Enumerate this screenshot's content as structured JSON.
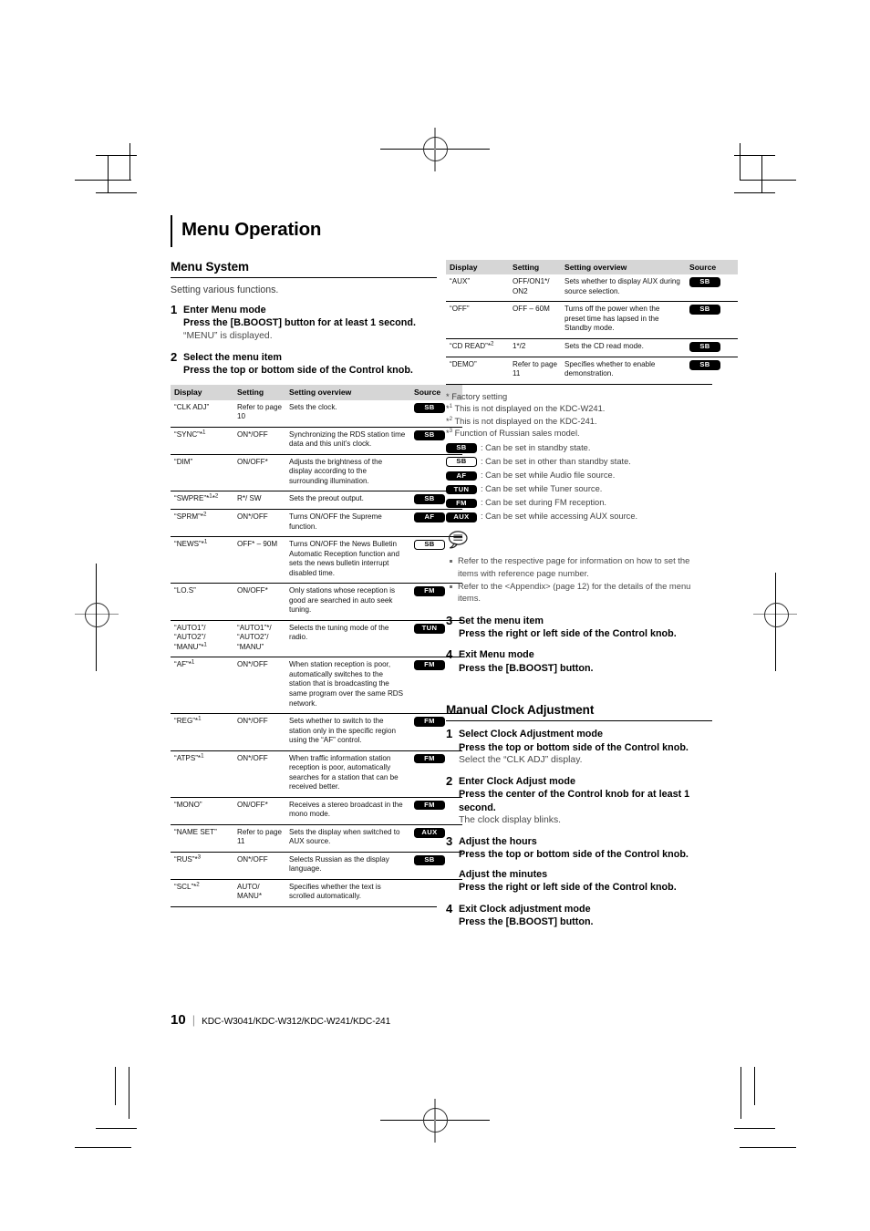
{
  "page_title": "Menu Operation",
  "left": {
    "section_title": "Menu System",
    "lead": "Setting various functions.",
    "steps": [
      {
        "num": "1",
        "hd": "Enter Menu mode",
        "sub": "Press the [B.BOOST] button for at least 1 second.",
        "note": "“MENU” is displayed."
      },
      {
        "num": "2",
        "hd": "Select the menu item",
        "sub": "Press the top or bottom side of the Control knob.",
        "note": ""
      }
    ],
    "table": {
      "headers": [
        "Display",
        "Setting",
        "Setting overview",
        "Source"
      ],
      "rows": [
        {
          "display": "“CLK ADJ”",
          "display_sup": "",
          "setting": "Refer to page 10",
          "overview": "Sets the clock.",
          "badge": "SB",
          "badge_style": "solid"
        },
        {
          "display": "“SYNC”",
          "display_sup": "*1",
          "setting": "ON*/OFF",
          "overview": "Synchronizing the RDS station time data and this unit’s clock.",
          "badge": "SB",
          "badge_style": "solid"
        },
        {
          "display": "“DIM”",
          "display_sup": "",
          "setting": "ON/OFF*",
          "overview": "Adjusts the brightness of the display according to the surrounding illumination.",
          "badge": "",
          "badge_style": "none"
        },
        {
          "display": "“SWPRE”",
          "display_sup": "*1*2",
          "setting": "R*/ SW",
          "overview": "Sets the preout output.",
          "badge": "SB",
          "badge_style": "solid"
        },
        {
          "display": "“SPRM”",
          "display_sup": "*2",
          "setting": "ON*/OFF",
          "overview": "Turns ON/OFF the Supreme function.",
          "badge": "AF",
          "badge_style": "solid"
        },
        {
          "display": "“NEWS”",
          "display_sup": "*1",
          "setting": "OFF* – 90M",
          "overview": "Turns ON/OFF the News Bulletin Automatic Reception function and sets the news bulletin interrupt disabled time.",
          "badge": "SB",
          "badge_style": "outline"
        },
        {
          "display": "“LO.S”",
          "display_sup": "",
          "setting": "ON/OFF*",
          "overview": "Only stations whose reception is good are searched in auto seek tuning.",
          "badge": "FM",
          "badge_style": "solid"
        },
        {
          "display": "“AUTO1”/ “AUTO2”/ “MANU”",
          "display_sup": "*1",
          "setting": "“AUTO1”*/ “AUTO2”/ “MANU”",
          "overview": "Selects the tuning mode of the radio.",
          "badge": "TUN",
          "badge_style": "solid"
        },
        {
          "display": "“AF”",
          "display_sup": "*1",
          "setting": "ON*/OFF",
          "overview": "When station reception is poor, automatically switches to the station that is broadcasting the same program over the same RDS network.",
          "badge": "FM",
          "badge_style": "solid"
        },
        {
          "display": "“REG”",
          "display_sup": "*1",
          "setting": "ON*/OFF",
          "overview": "Sets whether to switch to the station only in the specific region using the “AF” control.",
          "badge": "FM",
          "badge_style": "solid"
        },
        {
          "display": "“ATPS”",
          "display_sup": "*1",
          "setting": "ON*/OFF",
          "overview": "When traffic information station reception is poor, automatically searches for a station that can be received better.",
          "badge": "FM",
          "badge_style": "solid"
        },
        {
          "display": "“MONO”",
          "display_sup": "",
          "setting": "ON/OFF*",
          "overview": "Receives a stereo broadcast in the mono mode.",
          "badge": "FM",
          "badge_style": "solid"
        },
        {
          "display": "“NAME SET”",
          "display_sup": "",
          "setting": "Refer to page 11",
          "overview": "Sets the display when switched to AUX source.",
          "badge": "AUX",
          "badge_style": "solid"
        },
        {
          "display": "“RUS”",
          "display_sup": "*3",
          "setting": "ON*/OFF",
          "overview": "Selects Russian as the display language.",
          "badge": "SB",
          "badge_style": "solid"
        },
        {
          "display": "“SCL”",
          "display_sup": "*2",
          "setting": "AUTO/ MANU*",
          "overview": "Specifies whether the text is scrolled automatically.",
          "badge": "",
          "badge_style": "none"
        }
      ]
    }
  },
  "right": {
    "table": {
      "headers": [
        "Display",
        "Setting",
        "Setting overview",
        "Source"
      ],
      "rows": [
        {
          "display": "“AUX”",
          "display_sup": "",
          "setting": "OFF/ON1*/ ON2",
          "overview": "Sets whether to display AUX during source selection.",
          "badge": "SB",
          "badge_style": "solid"
        },
        {
          "display": "“OFF”",
          "display_sup": "",
          "setting": "OFF – 60M",
          "overview": "Turns off the power when the preset time has lapsed in the Standby mode.",
          "badge": "SB",
          "badge_style": "solid"
        },
        {
          "display": "“CD READ”",
          "display_sup": "*2",
          "setting": "1*/2",
          "overview": "Sets the CD read mode.",
          "badge": "SB",
          "badge_style": "solid"
        },
        {
          "display": "“DEMO”",
          "display_sup": "",
          "setting": "Refer to page 11",
          "overview": "Specifies whether to enable demonstration.",
          "badge": "SB",
          "badge_style": "solid"
        }
      ]
    },
    "footnotes": [
      {
        "mark": "*",
        "sup": "",
        "text": "Factory setting"
      },
      {
        "mark": "*",
        "sup": "1",
        "text": "This is not displayed on the KDC-W241."
      },
      {
        "mark": "*",
        "sup": "2",
        "text": "This is not displayed on the KDC-241."
      },
      {
        "mark": "*",
        "sup": "3",
        "text": "Function of Russian sales model."
      }
    ],
    "legend": [
      {
        "badge": "SB",
        "badge_style": "solid",
        "text": ": Can be set in standby state."
      },
      {
        "badge": "SB",
        "badge_style": "outline",
        "text": ": Can be set in other than standby state."
      },
      {
        "badge": "AF",
        "badge_style": "solid",
        "text": ": Can be set while Audio file source."
      },
      {
        "badge": "TUN",
        "badge_style": "solid",
        "text": ": Can be set while Tuner source."
      },
      {
        "badge": "FM",
        "badge_style": "solid",
        "text": ": Can be set during FM reception."
      },
      {
        "badge": "AUX",
        "badge_style": "solid",
        "text": ": Can be set while accessing AUX source."
      }
    ],
    "notes": [
      "Refer to the respective page for information on how to set the items with reference page number.",
      "Refer to the <Appendix> (page 12) for the details of the menu items."
    ],
    "steps": [
      {
        "num": "3",
        "hd": "Set the menu item",
        "sub": "Press the right or left side of the Control knob."
      },
      {
        "num": "4",
        "hd": "Exit Menu mode",
        "sub": "Press the [B.BOOST] button."
      }
    ],
    "section2_title": "Manual Clock Adjustment",
    "steps2": [
      {
        "num": "1",
        "hd": "Select Clock Adjustment mode",
        "sub": "Press the top or bottom side of the Control knob.",
        "note": "Select the “CLK ADJ” display.",
        "sub2": "",
        "sub2b": ""
      },
      {
        "num": "2",
        "hd": "Enter Clock Adjust mode",
        "sub": "Press the center of the Control knob for at least 1 second.",
        "note": "The clock display blinks.",
        "sub2": "",
        "sub2b": ""
      },
      {
        "num": "3",
        "hd": "Adjust the hours",
        "sub": "Press the top or bottom side of the Control knob.",
        "note": "",
        "sub2": "Adjust the minutes",
        "sub2b": "Press the right or left side of the Control knob."
      },
      {
        "num": "4",
        "hd": "Exit Clock adjustment mode",
        "sub": "Press the [B.BOOST] button.",
        "note": "",
        "sub2": "",
        "sub2b": ""
      }
    ]
  },
  "footer": {
    "page_number": "10",
    "divider": "|",
    "models": "KDC-W3041/KDC-W312/KDC-W241/KDC-241"
  }
}
